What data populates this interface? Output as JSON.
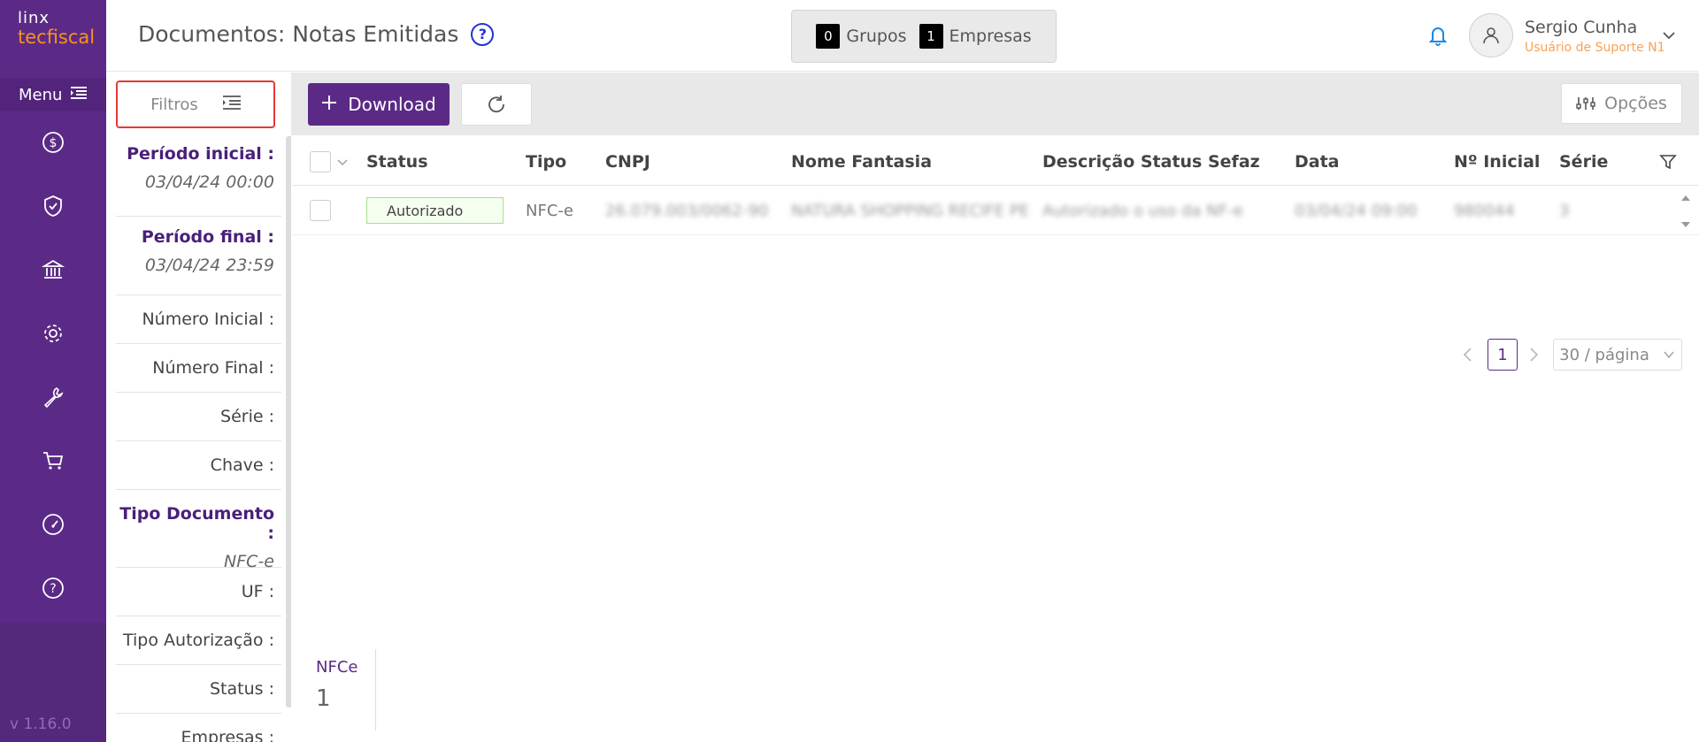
{
  "nav": {
    "logo_line1": "linx",
    "logo_line2": "tecfiscal",
    "menu_label": "Menu",
    "version": "v 1.16.0",
    "icons": [
      "dollar-icon",
      "shield-check-icon",
      "bank-icon",
      "gear-icon",
      "wrench-icon",
      "cart-icon",
      "dashboard-icon",
      "help-icon"
    ]
  },
  "header": {
    "title": "Documentos: Notas Emitidas",
    "help_symbol": "?",
    "groups_count": "0",
    "groups_label": "Grupos",
    "companies_count": "1",
    "companies_label": "Empresas",
    "user_name": "Sergio Cunha",
    "user_role": "Usuário de Suporte N1"
  },
  "filters": {
    "button_label": "Filtros",
    "items": [
      {
        "label": "Período inicial :",
        "value": "03/04/24 00:00",
        "highlight": true
      },
      {
        "label": "Período final :",
        "value": "03/04/24 23:59",
        "highlight": true
      },
      {
        "label": "Número Inicial :",
        "value": ""
      },
      {
        "label": "Número Final :",
        "value": ""
      },
      {
        "label": "Série :",
        "value": ""
      },
      {
        "label": "Chave :",
        "value": ""
      },
      {
        "label": "Tipo Documento :",
        "value": "NFC-e",
        "highlight": true
      },
      {
        "label": "UF :",
        "value": ""
      },
      {
        "label": "Tipo Autorização :",
        "value": ""
      },
      {
        "label": "Status :",
        "value": ""
      },
      {
        "label": "Empresas :",
        "value": ""
      }
    ]
  },
  "toolbar": {
    "download_label": "Download",
    "options_label": "Opções"
  },
  "table": {
    "headers": [
      "Status",
      "Tipo",
      "CNPJ",
      "Nome Fantasia",
      "Descrição Status Sefaz",
      "Data",
      "Nº Inicial",
      "Série"
    ],
    "rows": [
      {
        "status": "Autorizado",
        "tipo": "NFC-e",
        "cnpj": "26.079.003/0062-90",
        "nome_fantasia": "NATURA SHOPPING RECIFE PE",
        "descricao": "Autorizado o uso da NF-e",
        "data": "03/04/24 09:00",
        "numero_inicial": "980044",
        "serie": "3"
      }
    ]
  },
  "pagination": {
    "current_page": "1",
    "per_page": "30 / página"
  },
  "summary": {
    "label": "NFCe",
    "value": "1"
  },
  "colors": {
    "primary": "#5b2a86",
    "accent": "#f7931e",
    "highlight_border": "#e53935",
    "status_success_border": "#a6e08b"
  }
}
